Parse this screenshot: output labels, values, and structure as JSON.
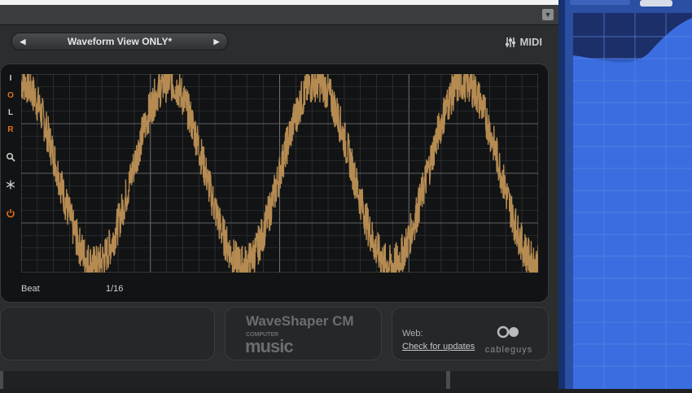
{
  "plugin": {
    "preset_prev_icon": "triangle-left-icon",
    "preset_next_icon": "triangle-right-icon",
    "preset_name": "Waveform View ONLY*",
    "midi_label": "MIDI",
    "side_buttons": [
      "I",
      "O",
      "L",
      "R"
    ],
    "beat_label": "Beat",
    "beat_value": "1/16",
    "brand_title": "WaveShaper CM",
    "brand_sub": "COMPUTER",
    "brand_music": "music",
    "web_label": "Web:",
    "web_link": "Check for updates",
    "vendor": "cableguys"
  },
  "colors": {
    "waveform": "#b58b52",
    "accent_orange": "#e0701c",
    "grid": "#3b3d3f",
    "host_blue": "#2a4fa3"
  },
  "waveform": {
    "cycles": 3.5,
    "phase_start": 0.25,
    "noise": 0.22
  }
}
